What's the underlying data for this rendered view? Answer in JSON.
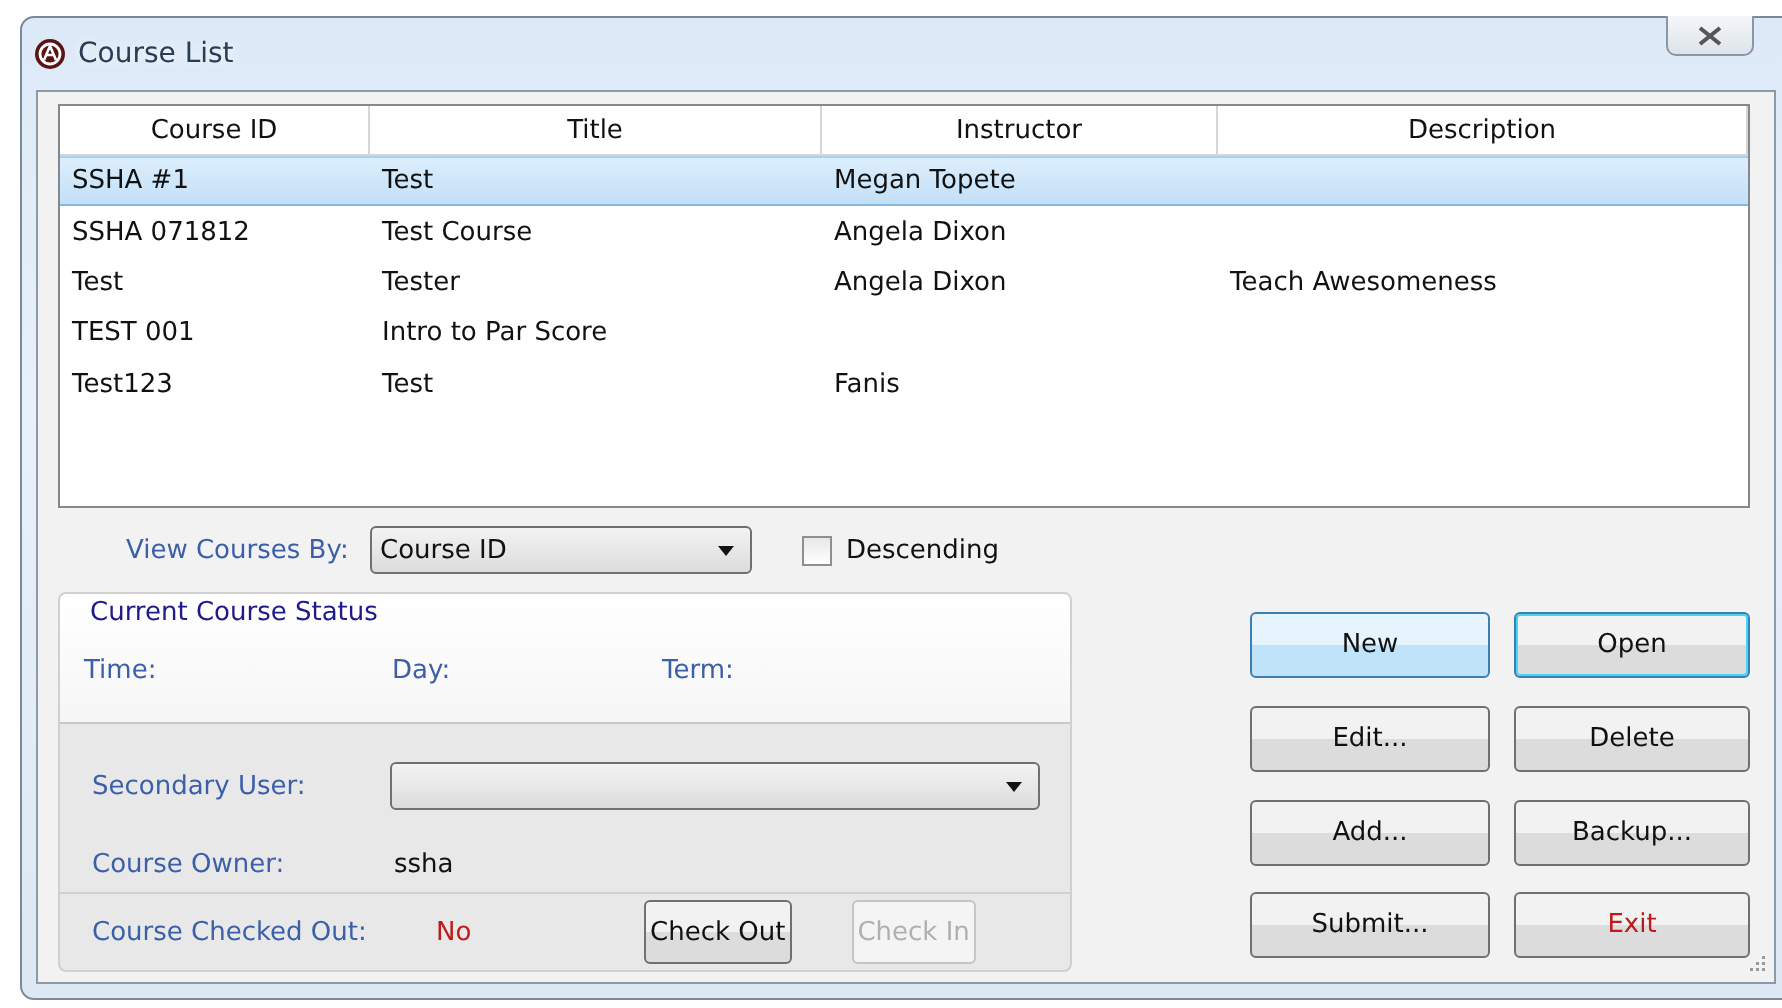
{
  "window": {
    "title": "Course List"
  },
  "table": {
    "columns": [
      "Course ID",
      "Title",
      "Instructor",
      "Description"
    ],
    "rows": [
      {
        "cells": [
          "SSHA #1",
          "Test",
          "Megan Topete",
          ""
        ],
        "selected": true
      },
      {
        "cells": [
          "SSHA 071812",
          "Test Course",
          "Angela Dixon",
          ""
        ],
        "selected": false
      },
      {
        "cells": [
          "Test",
          "Tester",
          "Angela Dixon",
          "Teach Awesomeness"
        ],
        "selected": false
      },
      {
        "cells": [
          "TEST 001",
          "Intro to Par Score",
          "",
          ""
        ],
        "selected": false
      },
      {
        "cells": [
          "Test123",
          "Test",
          "Fanis",
          ""
        ],
        "selected": false
      }
    ]
  },
  "view_by": {
    "label": "View Courses By:",
    "value": "Course ID",
    "descending": {
      "label": "Descending",
      "checked": false
    }
  },
  "status": {
    "title": "Current Course Status",
    "time": "Time:",
    "day": "Day:",
    "term": "Term:",
    "secondary_user": {
      "label": "Secondary User:"
    },
    "owner": {
      "label": "Course Owner:",
      "value": "ssha"
    },
    "checked_out": {
      "label": "Course Checked Out:",
      "value": "No"
    },
    "buttons": [
      {
        "label": "Check Out",
        "disabled": false
      },
      {
        "label": "Check In",
        "disabled": true
      }
    ]
  },
  "buttons": [
    {
      "label": "New",
      "kind": "hot"
    },
    {
      "label": "Open",
      "kind": "focused"
    },
    {
      "label": "Edit...",
      "kind": "normal"
    },
    {
      "label": "Delete",
      "kind": "normal"
    },
    {
      "label": "Add...",
      "kind": "normal"
    },
    {
      "label": "Backup...",
      "kind": "normal"
    },
    {
      "label": "Submit...",
      "kind": "normal"
    },
    {
      "label": "Exit",
      "kind": "danger"
    }
  ]
}
